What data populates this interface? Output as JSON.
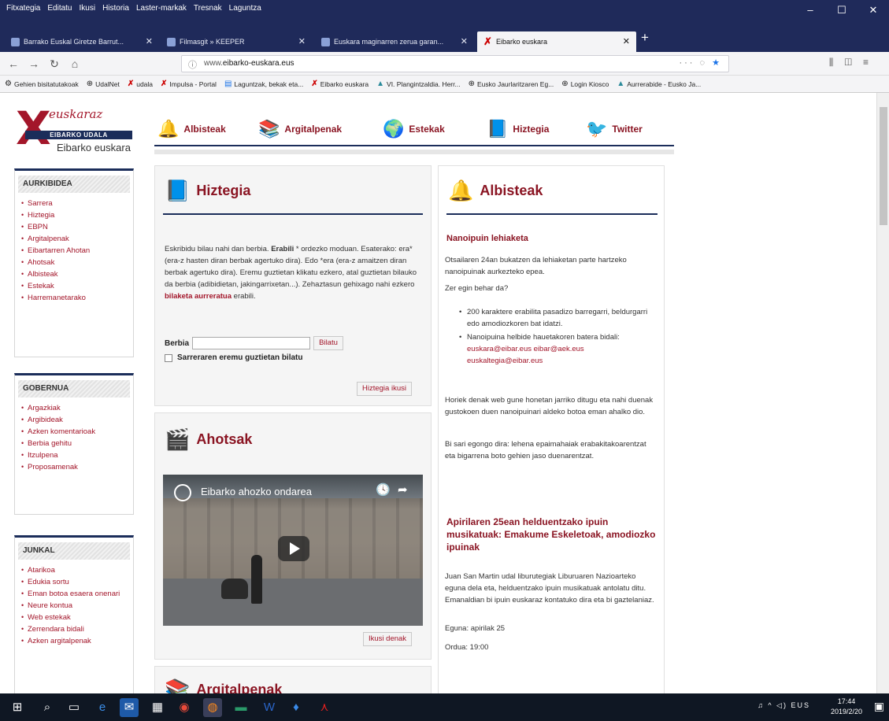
{
  "browser": {
    "menus": [
      "Fitxategia",
      "Editatu",
      "Ikusi",
      "Historia",
      "Laster-markak",
      "Tresnak",
      "Laguntza"
    ],
    "tabs": [
      {
        "label": "Barrako Euskal Giretze Barrut..."
      },
      {
        "label": "Filmasgit » KEEPER"
      },
      {
        "label": "Euskara maginarren zerua garan..."
      },
      {
        "label": "Eibarko euskara"
      }
    ],
    "url_prefix": "www.",
    "url_domain": "eibarko-euskara.eus",
    "bookmarks": [
      "Gehien bisitatutakoak",
      "UdalNet",
      "udala",
      "Impulsa - Portal",
      "Laguntzak, bekak eta...",
      "Eibarko euskara",
      "VI. Plangintzaldia. Herr...",
      "Eusko Jaurlaritzaren Eg...",
      "Login Kiosco",
      "Aurrerabide - Eusko Ja..."
    ]
  },
  "site": {
    "logo_script": "euskaraz",
    "logo_band": "EIBARKO UDALA",
    "logo_sub": "Eibarko euskara",
    "nav": [
      {
        "label": "Albisteak",
        "icon": "bell-icon"
      },
      {
        "label": "Argitalpenak",
        "icon": "books-icon"
      },
      {
        "label": "Estekak",
        "icon": "globe-icon"
      },
      {
        "label": "Hiztegia",
        "icon": "book-icon"
      },
      {
        "label": "Twitter",
        "icon": "bird-icon"
      }
    ]
  },
  "sidebar": {
    "aurkibidea": {
      "title": "AURKIBIDEA",
      "items": [
        "Sarrera",
        "Hiztegia",
        "EBPN",
        "Argitalpenak",
        "Eibartarren Ahotan",
        "Ahotsak",
        "Albisteak",
        "Estekak",
        "Harremanetarako"
      ]
    },
    "gobernua": {
      "title": "GOBERNUA",
      "items": [
        "Argazkiak",
        "Argibideak",
        "Azken komentarioak",
        "Berbia gehitu",
        "Itzulpena",
        "Proposamenak"
      ]
    },
    "junkal": {
      "title": "JUNKAL",
      "items": [
        "Atarikoa",
        "Edukia sortu",
        "Eman botoa esaera onenari",
        "Neure kontua",
        "Web estekak",
        "Zerrendara bidali",
        "Azken argitalpenak"
      ]
    }
  },
  "hiztegia": {
    "title": "Hiztegia",
    "intro_1": "Eskribidu bilau nahi dan berbia. ",
    "intro_bold": "Erabili",
    "intro_2": " * ordezko moduan. Esaterako: era* (era-z hasten diran berbak agertuko dira). Edo *era (era-z amaitzen diran berbak agertuko dira). Eremu guztietan klikatu ezkero, atal guztietan bilauko da berbia (adibidietan, jakingarrixetan...). Zehaztasun gehixago nahi ezkero ",
    "intro_link": "bilaketa aurreratua",
    "intro_3": " erabili.",
    "search_label": "Berbia",
    "search_value": "",
    "search_button": "Bilatu",
    "checkbox_label": "Sarreraren eremu guztietan bilatu",
    "more_button": "Hiztegia ikusi"
  },
  "ahotsak": {
    "title": "Ahotsak",
    "video_title": "Eibarko ahozko ondarea",
    "more_button": "Ikusi denak"
  },
  "argitalpenak": {
    "title": "Argitalpenak"
  },
  "albisteak": {
    "title": "Albisteak",
    "n1_title": "Nanoipuin lehiaketa",
    "n1_p1": "Otsailaren 24an bukatzen da lehiaketan parte hartzeko nanoipuinak aurkezteko epea.",
    "n1_p2": "Zer egin behar da?",
    "n1_li1": "200 karaktere erabilita pasadizo barregarri, beldurgarri edo amodiozkoren bat idatzi.",
    "n1_li2_text": "Nanoipuina helbide hauetakoren batera bidali: ",
    "n1_li2_link": "euskara@eibar.eus eibar@aek.eus euskaltegia@eibar.eus",
    "n1_p3": "Horiek denak web gune honetan jarriko ditugu eta nahi duenak gustokoen duen nanoipuinari aldeko botoa eman ahalko dio.",
    "n1_p4": "Bi sari egongo dira: lehena epaimahaiak erabakitakoarentzat eta bigarrena boto gehien jaso duenarentzat.",
    "n2_title": "Apirilaren 25ean helduentzako ipuin musikatuak: Emakume Eskeletoak, amodiozko ipuinak",
    "n2_p1": "Juan San Martin udal liburutegiak Liburuaren Nazioarteko eguna dela eta, helduentzako ipuin musikatuak antolatu ditu. Emanaldian bi ipuin euskaraz kontatuko dira eta bi gaztelaniaz.",
    "n2_p2": "Eguna: apirilak 25",
    "n2_p3": "Ordua: 19:00"
  },
  "taskbar": {
    "lang": "EUS",
    "time": "17:44",
    "date": "2019/2/20"
  },
  "colors": {
    "brand": "#8a1422",
    "navy": "#1b2d5a",
    "chrome": "#1f2a5a"
  }
}
